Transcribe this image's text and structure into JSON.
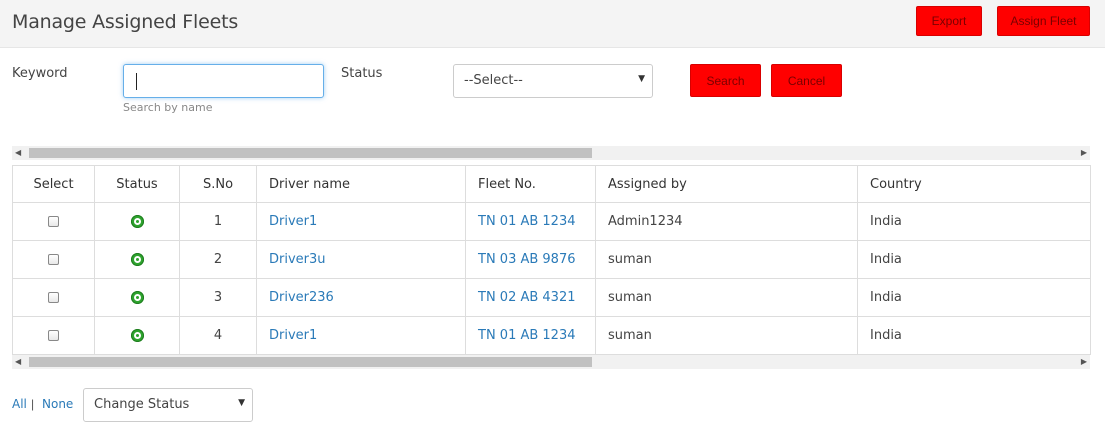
{
  "header": {
    "title": "Manage Assigned Fleets",
    "export_label": "Export",
    "assign_label": "Assign Fleet"
  },
  "filters": {
    "keyword_label": "Keyword",
    "keyword_value": "",
    "keyword_hint": "Search by name",
    "status_label": "Status",
    "status_selected": "--Select--",
    "search_label": "Search",
    "cancel_label": "Cancel"
  },
  "table": {
    "columns": [
      "Select",
      "Status",
      "S.No",
      "Driver name",
      "Fleet No.",
      "Assigned by",
      "Country"
    ],
    "rows": [
      {
        "sno": "1",
        "driver": "Driver1",
        "fleet": "TN 01 AB 1234",
        "assigned_by": "Admin1234",
        "country": "India",
        "status_icon": "active-status-icon"
      },
      {
        "sno": "2",
        "driver": "Driver3u",
        "fleet": "TN 03 AB 9876",
        "assigned_by": "suman",
        "country": "India",
        "status_icon": "active-status-icon"
      },
      {
        "sno": "3",
        "driver": "Driver236",
        "fleet": "TN 02 AB 4321",
        "assigned_by": "suman",
        "country": "India",
        "status_icon": "active-status-icon"
      },
      {
        "sno": "4",
        "driver": "Driver1",
        "fleet": "TN 01 AB 1234",
        "assigned_by": "suman",
        "country": "India",
        "status_icon": "active-status-icon"
      }
    ]
  },
  "footer": {
    "all_label": "All",
    "separator": "|",
    "none_label": "None",
    "change_status_selected": "Change Status"
  },
  "colors": {
    "button_red": "#ff0000",
    "link_blue": "#2a7ab8",
    "status_green": "#2ea32e"
  }
}
